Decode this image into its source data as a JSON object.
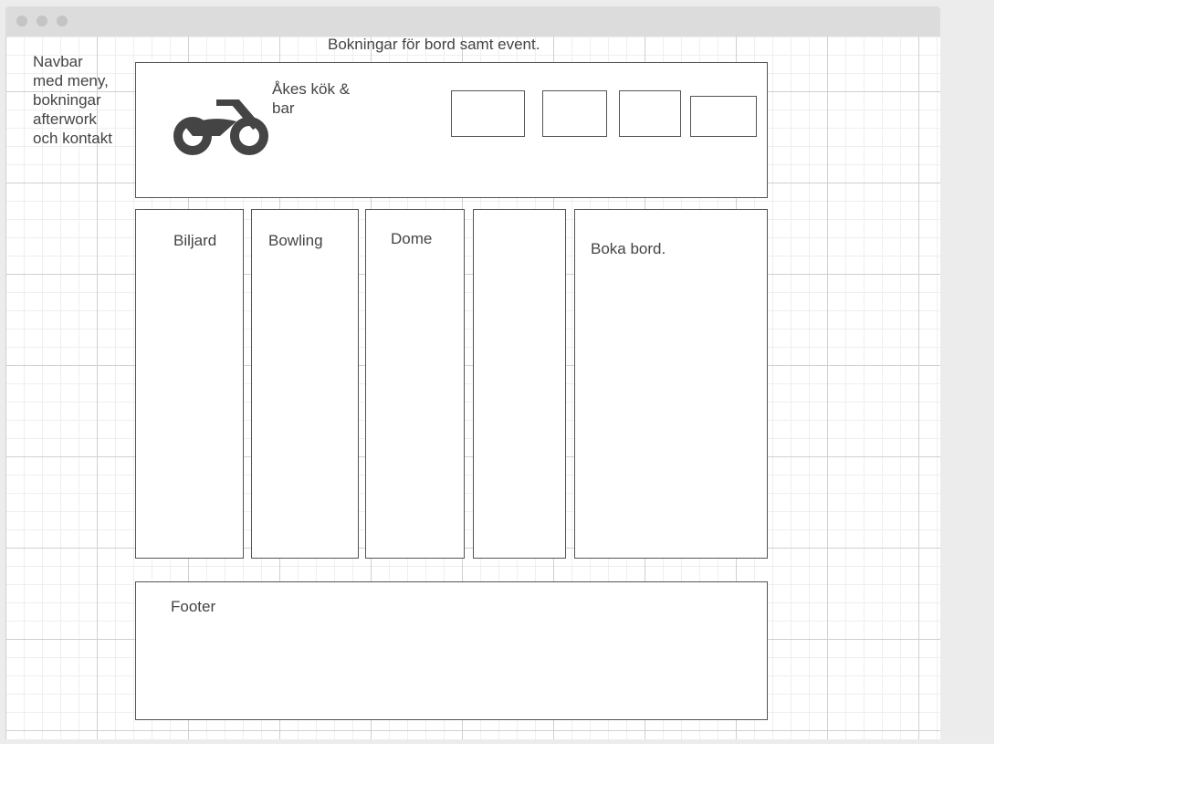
{
  "page": {
    "title": "Bokningar för bord samt event.",
    "navbar_note": "Navbar med meny, bokningar afterwork och kontakt"
  },
  "header": {
    "logo_icon": "motorcycle-icon",
    "brand": "Åkes kök & bar",
    "nav_buttons": [
      "",
      "",
      "",
      ""
    ]
  },
  "columns": [
    {
      "label": "Biljard"
    },
    {
      "label": "Bowling"
    },
    {
      "label": "Dome"
    },
    {
      "label": ""
    },
    {
      "label": "Boka bord."
    }
  ],
  "footer": {
    "label": "Footer"
  },
  "colors": {
    "text": "#444444",
    "border": "#555555",
    "titlebar": "#dcdcdc",
    "icon": "#444444"
  }
}
